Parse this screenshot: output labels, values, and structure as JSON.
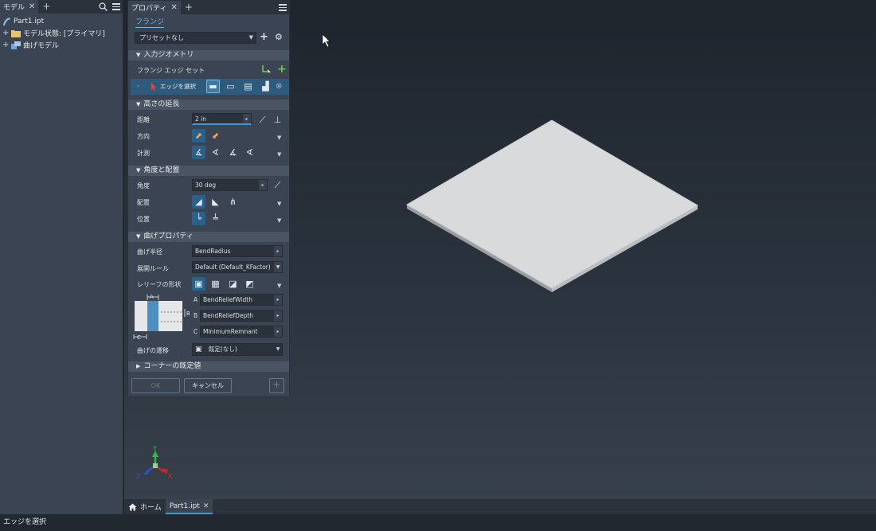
{
  "browser": {
    "tab_label": "モデル",
    "tree": [
      {
        "label": "Part1.ipt"
      },
      {
        "label": "モデル状態: [プライマリ]"
      },
      {
        "label": "曲げモデル"
      }
    ]
  },
  "props": {
    "tab_label": "プロパティ",
    "title": "フランジ",
    "preset": "プリセットなし",
    "sections": {
      "input_geometry": "入力ジオメトリ",
      "height_extent": "高さの延長",
      "angle_placement": "角度と配置",
      "bend_props": "曲げプロパティ",
      "corner_defaults": "コーナーの既定値"
    },
    "flange_edge_set": "フランジ エッジ セット",
    "select_edge": "エッジを選択",
    "distance_label": "距離",
    "distance_value": "2 in",
    "direction_label": "方向",
    "measure_label": "計測",
    "angle_label": "角度",
    "angle_value": "30 deg",
    "placement_label": "配置",
    "position_label": "位置",
    "bend_radius_label": "曲げ半径",
    "bend_radius_value": "BendRadius",
    "unfold_rule_label": "展開ルール",
    "unfold_rule_value": "Default (Default_KFactor)",
    "relief_shape_label": "レリーフの形状",
    "relief_a_label": "A",
    "relief_a_value": "BendReliefWidth",
    "relief_b_label": "B",
    "relief_b_value": "BendReliefDepth",
    "relief_c_label": "C",
    "relief_c_value": "MinimumRemnant",
    "diagram_a": "A",
    "diagram_b": "B",
    "diagram_c": "C",
    "bend_transition_label": "曲げの遷移",
    "bend_transition_value": "既定(なし)",
    "ok": "OK",
    "cancel": "キャンセル"
  },
  "doc_tabs": {
    "home": "ホーム",
    "part": "Part1.ipt"
  },
  "axes": {
    "x": "X",
    "y": "Y",
    "z": "Z"
  },
  "status": "エッジを選択",
  "colors": {
    "accent": "#3b9ad9",
    "panel": "#3a4452",
    "selected": "#27618c"
  }
}
